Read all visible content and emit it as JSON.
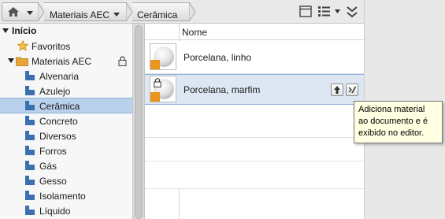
{
  "breadcrumb": {
    "segments": [
      "Materiais AEC",
      "Cerâmica"
    ]
  },
  "toolbar": {
    "icons": [
      "home-icon",
      "chevron-down-icon",
      "panel-toggle-icon",
      "list-view-icon",
      "chevron-down-icon",
      "collapse-icon"
    ]
  },
  "tree": {
    "root_label": "Início",
    "items": [
      {
        "label": "Favoritos",
        "icon": "star-icon"
      },
      {
        "label": "Materiais AEC",
        "icon": "folder-icon",
        "locked": true
      },
      {
        "label": "Alvenaria",
        "icon": "material-category-icon"
      },
      {
        "label": "Azulejo",
        "icon": "material-category-icon"
      },
      {
        "label": "Cerâmica",
        "icon": "material-category-icon",
        "selected": true
      },
      {
        "label": "Concreto",
        "icon": "material-category-icon"
      },
      {
        "label": "Diversos",
        "icon": "material-category-icon"
      },
      {
        "label": "Forros",
        "icon": "material-category-icon"
      },
      {
        "label": "Gás",
        "icon": "material-category-icon"
      },
      {
        "label": "Gesso",
        "icon": "material-category-icon"
      },
      {
        "label": "Isolamento",
        "icon": "material-category-icon"
      },
      {
        "label": "Líquido",
        "icon": "material-category-icon"
      }
    ]
  },
  "list": {
    "column_name": "Nome",
    "rows": [
      {
        "name": "Porcelana, linho",
        "selected": false,
        "locked": false
      },
      {
        "name": "Porcelana, marfim",
        "selected": true,
        "locked": true
      }
    ]
  },
  "tooltip": {
    "lines": [
      "Adiciona material",
      "ao documento e é",
      "exibido no editor."
    ]
  },
  "colors": {
    "selection": "#b9d1ec",
    "row_selection": "#dde7f3",
    "folder": "#e8a33a",
    "category_icon": "#3a6fb0",
    "tooltip_bg": "#ffffe1"
  }
}
